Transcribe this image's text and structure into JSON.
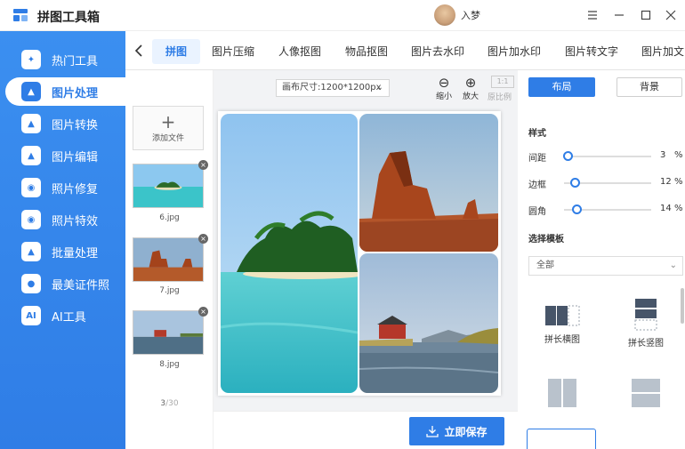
{
  "app": {
    "title": "拼图工具箱"
  },
  "user": {
    "name": "入梦"
  },
  "window_controls": [
    "menu-icon",
    "minimize-icon",
    "maximize-icon",
    "close-icon"
  ],
  "sidebar": {
    "items": [
      {
        "label": "热门工具",
        "icon": "hot-tools-icon",
        "active": false
      },
      {
        "label": "图片处理",
        "icon": "image-process-icon",
        "active": true
      },
      {
        "label": "图片转换",
        "icon": "image-convert-icon",
        "active": false
      },
      {
        "label": "图片编辑",
        "icon": "image-edit-icon",
        "active": false
      },
      {
        "label": "照片修复",
        "icon": "photo-repair-icon",
        "active": false
      },
      {
        "label": "照片特效",
        "icon": "photo-effect-icon",
        "active": false
      },
      {
        "label": "批量处理",
        "icon": "batch-icon",
        "active": false
      },
      {
        "label": "最美证件照",
        "icon": "id-photo-icon",
        "active": false
      },
      {
        "label": "AI工具",
        "icon": "ai-icon",
        "active": false
      }
    ],
    "ai_badge": "AI"
  },
  "tabs": [
    "拼图",
    "图片压缩",
    "人像抠图",
    "物品抠图",
    "图片去水印",
    "图片加水印",
    "图片转文字",
    "图片加文"
  ],
  "files": {
    "add_label": "添加文件",
    "items": [
      {
        "name": "6.jpg"
      },
      {
        "name": "7.jpg"
      },
      {
        "name": "8.jpg"
      }
    ],
    "counter_current": "3",
    "counter_total": "/30"
  },
  "canvas": {
    "size_label": "画布尺寸:1200*1200px",
    "zoom_out": "缩小",
    "zoom_in": "放大",
    "ratio_box": "1:1",
    "ratio_label": "原比例"
  },
  "save_button": "立即保存",
  "panel": {
    "layout_tab": "布局",
    "background_tab": "背景",
    "style_title": "样式",
    "sliders": [
      {
        "label": "间距",
        "value": "3",
        "unit": "%",
        "fraction": 0.03
      },
      {
        "label": "边框",
        "value": "12",
        "unit": "%",
        "fraction": 0.12
      },
      {
        "label": "圆角",
        "value": "14",
        "unit": "%",
        "fraction": 0.14
      }
    ],
    "template_title": "选择模板",
    "template_select": "全部",
    "templates": [
      {
        "label": "拼长横图"
      },
      {
        "label": "拼长竖图"
      }
    ]
  },
  "colors": {
    "accent": "#2f7de6",
    "sidebar": "#3b8ff0"
  }
}
